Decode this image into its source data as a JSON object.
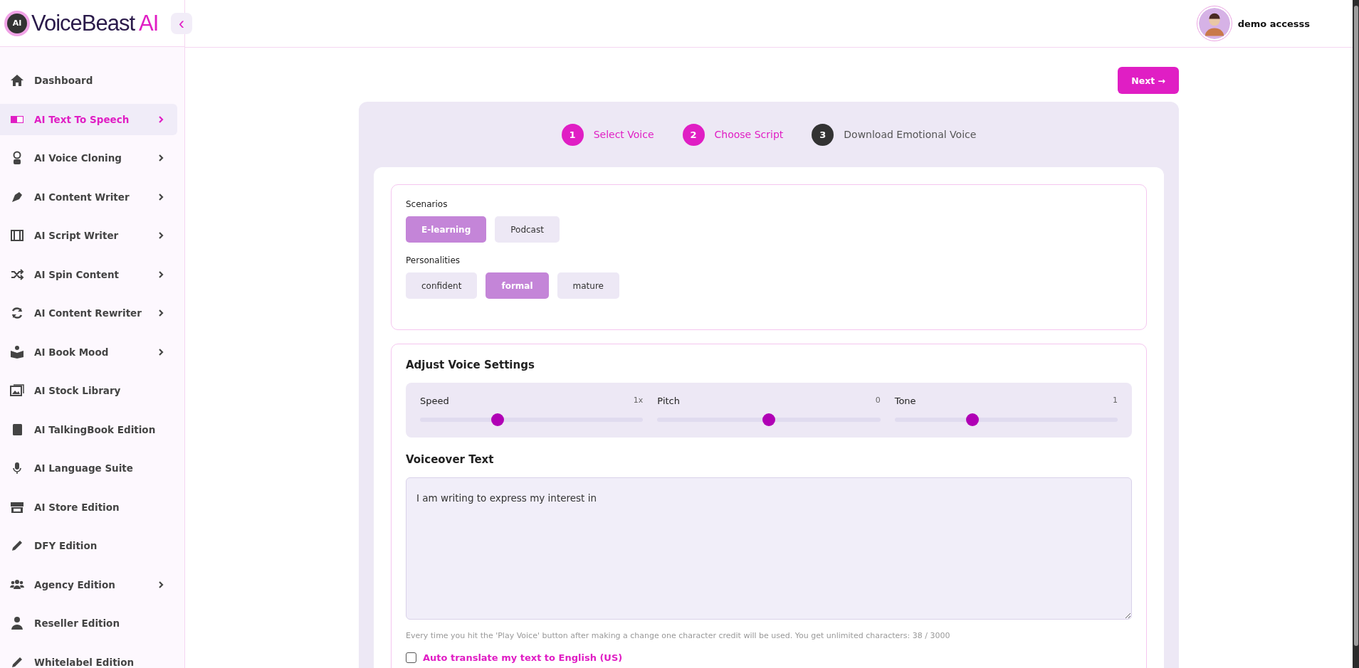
{
  "brand": {
    "badge": "AI",
    "name": "VoiceBeast",
    "suffix": "AI",
    "collapse": "‹"
  },
  "user": {
    "name": "demo accesss"
  },
  "sidebar": {
    "items": [
      {
        "label": "Dashboard",
        "selected": false,
        "has_submenu": false
      },
      {
        "label": "AI Text To Speech",
        "selected": true,
        "has_submenu": true
      },
      {
        "label": "AI Voice Cloning",
        "selected": false,
        "has_submenu": true
      },
      {
        "label": "AI Content Writer",
        "selected": false,
        "has_submenu": true
      },
      {
        "label": "AI Script Writer",
        "selected": false,
        "has_submenu": true
      },
      {
        "label": "AI Spin Content",
        "selected": false,
        "has_submenu": true
      },
      {
        "label": "AI Content Rewriter",
        "selected": false,
        "has_submenu": true
      },
      {
        "label": "AI Book Mood",
        "selected": false,
        "has_submenu": true
      },
      {
        "label": "AI Stock Library",
        "selected": false,
        "has_submenu": false
      },
      {
        "label": "AI TalkingBook Edition",
        "selected": false,
        "has_submenu": false
      },
      {
        "label": "AI Language Suite",
        "selected": false,
        "has_submenu": false
      },
      {
        "label": "AI Store Edition",
        "selected": false,
        "has_submenu": false
      },
      {
        "label": "DFY Edition",
        "selected": false,
        "has_submenu": false
      },
      {
        "label": "Agency Edition",
        "selected": false,
        "has_submenu": true
      },
      {
        "label": "Reseller Edition",
        "selected": false,
        "has_submenu": false
      },
      {
        "label": "Whitelabel Edition",
        "selected": false,
        "has_submenu": false
      }
    ]
  },
  "next_button": "Next →",
  "steps": [
    {
      "number": "1",
      "label": "Select Voice",
      "active": true
    },
    {
      "number": "2",
      "label": "Choose Script",
      "active": true
    },
    {
      "number": "3",
      "label": "Download Emotional Voice",
      "active": false
    }
  ],
  "scenarios": {
    "label": "Scenarios",
    "options": [
      {
        "label": "E-learning",
        "selected": true
      },
      {
        "label": "Podcast",
        "selected": false
      }
    ]
  },
  "personalities": {
    "label": "Personalities",
    "options": [
      {
        "label": "confident",
        "selected": false
      },
      {
        "label": "formal",
        "selected": true
      },
      {
        "label": "mature",
        "selected": false
      }
    ]
  },
  "voice_settings": {
    "title": "Adjust Voice Settings",
    "sliders": [
      {
        "name": "Speed",
        "reading": "1x",
        "level": 0.34
      },
      {
        "name": "Pitch",
        "reading": "0",
        "level": 0.5
      },
      {
        "name": "Tone",
        "reading": "1",
        "level": 0.34
      }
    ]
  },
  "voiceover": {
    "title": "Voiceover Text",
    "value": "I am writing to express my interest in",
    "hint": "Every time you hit the 'Play Voice' button after making a change one character credit will be used. You get unlimited characters: 38 / 3000"
  },
  "auto_translate": {
    "label": "Auto translate my text to English (US)",
    "checked": false
  }
}
